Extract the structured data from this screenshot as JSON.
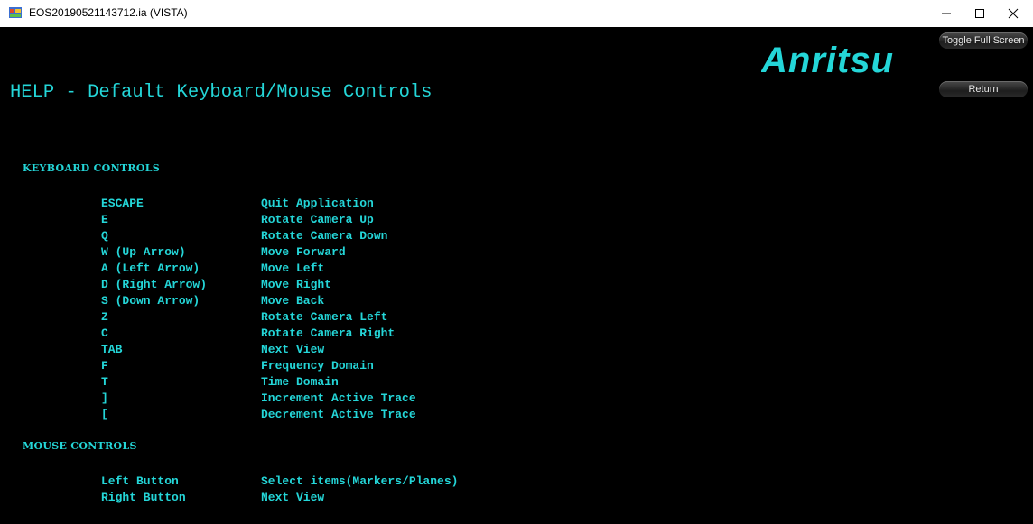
{
  "window": {
    "title": "EOS20190521143712.ia (VISTA)",
    "minimize_glyph": "—",
    "maximize_glyph": "☐",
    "close_glyph": "✕",
    "icon": "app-icon"
  },
  "logo": {
    "text": "Anritsu",
    "color": "#24d6d8"
  },
  "buttons": {
    "toggle_full_screen": "Toggle Full Screen",
    "return": "Return"
  },
  "help_title": "HELP - Default Keyboard/Mouse Controls",
  "keyboard": {
    "heading": "KEYBOARD CONTROLS",
    "rows": [
      {
        "key": "ESCAPE",
        "action": "Quit Application"
      },
      {
        "key": "E",
        "action": "Rotate Camera Up"
      },
      {
        "key": "Q",
        "action": "Rotate Camera Down"
      },
      {
        "key": "W (Up Arrow)",
        "action": "Move Forward"
      },
      {
        "key": "A (Left Arrow)",
        "action": "Move Left"
      },
      {
        "key": "D (Right Arrow)",
        "action": "Move Right"
      },
      {
        "key": "S (Down Arrow)",
        "action": "Move Back"
      },
      {
        "key": "Z",
        "action": "Rotate Camera Left"
      },
      {
        "key": "C",
        "action": "Rotate Camera Right"
      },
      {
        "key": "TAB",
        "action": "Next View"
      },
      {
        "key": "F",
        "action": "Frequency Domain"
      },
      {
        "key": "T",
        "action": "Time Domain"
      },
      {
        "key": "]",
        "action": "Increment Active Trace"
      },
      {
        "key": "[",
        "action": "Decrement Active Trace"
      }
    ]
  },
  "mouse": {
    "heading": "MOUSE CONTROLS",
    "rows": [
      {
        "key": "Left Button",
        "action": "Select items(Markers/Planes)"
      },
      {
        "key": "Right Button",
        "action": "Next View"
      }
    ]
  },
  "colors": {
    "accent": "#24d6d8",
    "background": "#000000"
  }
}
